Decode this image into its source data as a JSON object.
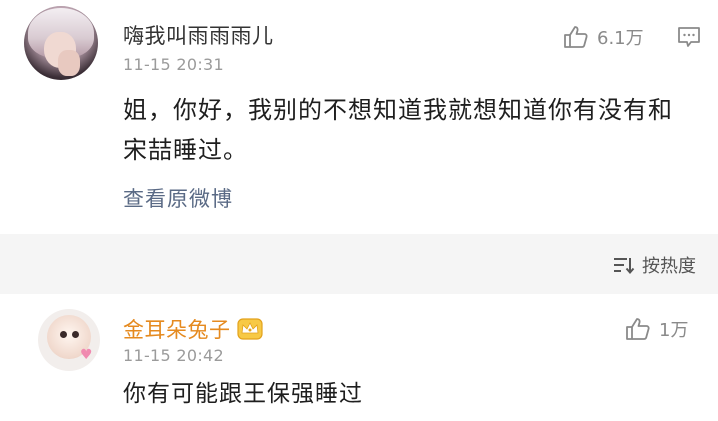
{
  "post": {
    "username": "嗨我叫雨雨雨儿",
    "timestamp": "11-15 20:31",
    "like_count": "6.1万",
    "text_line1": "姐，你好，我别的不想知道我就想知道你有没有和",
    "text_line2": "宋喆睡过。",
    "view_original": "查看原微博",
    "icons": {
      "like": "thumbs-up-icon",
      "comment": "comment-icon"
    }
  },
  "sortbar": {
    "sort_label": "按热度",
    "icon": "sort-icon"
  },
  "reply": {
    "username": "金耳朵兔子",
    "timestamp": "11-15 20:42",
    "like_count": "1万",
    "text": "你有可能跟王保强睡过",
    "icons": {
      "badge": "crown-badge-icon",
      "like": "thumbs-up-icon"
    }
  },
  "colors": {
    "link": "#5a6a85",
    "vip_name": "#e58a1f",
    "meta_gray": "#9b9b9b",
    "sortbar_bg": "#f5f5f5"
  }
}
